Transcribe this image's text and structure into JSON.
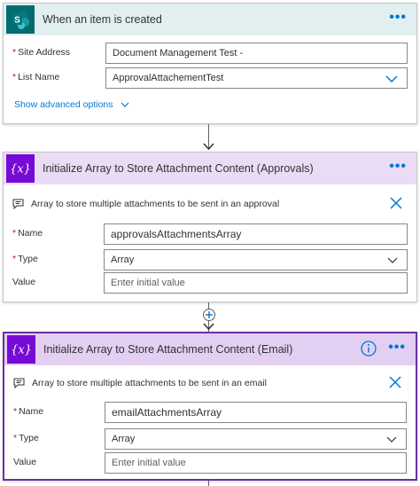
{
  "trigger": {
    "title": "When an item is created",
    "site_label": "Site Address",
    "site_value": "Document Management Test -",
    "list_label": "List Name",
    "list_value": "ApprovalAttachementTest",
    "advanced_link": "Show advanced options"
  },
  "approvals_step": {
    "title": "Initialize Array to Store Attachment Content (Approvals)",
    "comment": "Array to store multiple attachments to be sent in an approval",
    "name_label": "Name",
    "name_value": "approvalsAttachmentsArray",
    "type_label": "Type",
    "type_value": "Array",
    "value_label": "Value",
    "value_placeholder": "Enter initial value"
  },
  "email_step": {
    "title": "Initialize Array to Store Attachment Content (Email)",
    "comment": "Array to store multiple attachments to be sent in an email",
    "name_label": "Name",
    "name_value": "emailAttachmentsArray",
    "type_label": "Type",
    "type_value": "Array",
    "value_label": "Value",
    "value_placeholder": "Enter initial value"
  },
  "icons": {
    "sharepoint": "sharepoint-icon",
    "variable": "variable-icon",
    "more": "more-options-icon",
    "info": "info-icon",
    "comment": "comment-icon",
    "close": "close-icon",
    "chevron": "chevron-down-icon",
    "plus": "add-step-icon",
    "arrow": "arrow-down-icon"
  },
  "colors": {
    "sharepoint_header": "#e2eff0",
    "variable_header": "#ebdcf5",
    "variable_icon": "#770bd6",
    "sharepoint_icon": "#036c70",
    "accent": "#0078d4",
    "selected_border": "#6b2fa8"
  }
}
